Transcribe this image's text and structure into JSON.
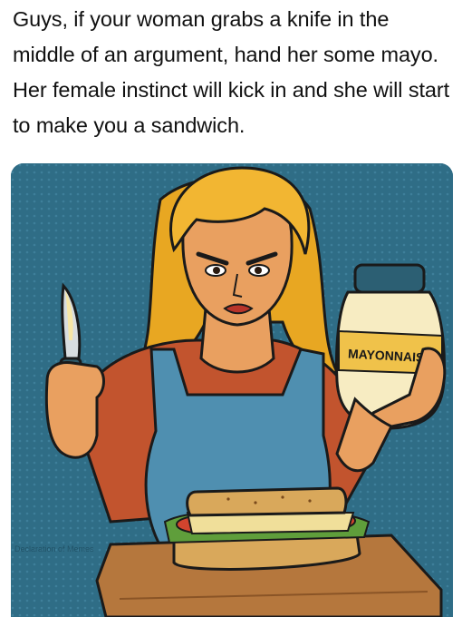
{
  "post": {
    "text": "Guys, if your woman grabs a knife in the middle of an argument, hand her some mayo. Her female instinct will kick in and she will start to make you a sandwich."
  },
  "illustration": {
    "jar_label": "MAYONNAISE",
    "watermark": "Declaration of Memes",
    "colors": {
      "background": "#2f6d86",
      "hair": "#f2b632",
      "skin": "#e9a060",
      "apron": "#4f8fb0",
      "shirt": "#c2542e",
      "jar": "#f7ecc2",
      "jar_lid": "#2c5f73",
      "label": "#f0c24a",
      "bread": "#d9a85b",
      "tomato": "#d2442e",
      "lettuce": "#5f9e3b",
      "board": "#b5773d"
    }
  }
}
